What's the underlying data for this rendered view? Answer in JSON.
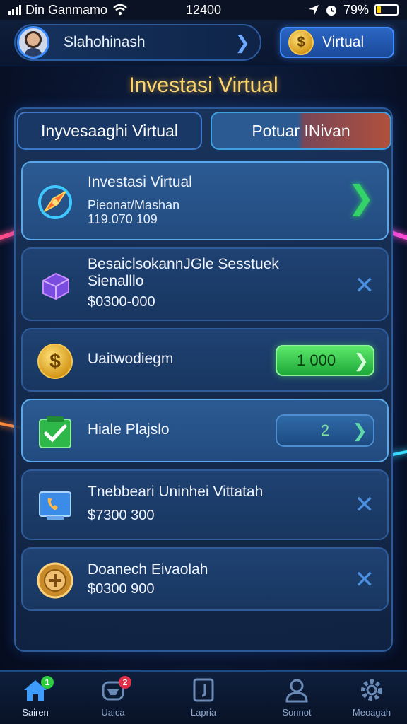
{
  "status_bar": {
    "carrier": "Din Ganmamo",
    "time": "12400",
    "battery": "79%"
  },
  "header": {
    "user_name": "Slahohinash",
    "virtual_label": "Virtual",
    "coin_symbol": "$"
  },
  "page_title": "Investasi Virtual",
  "tabs": [
    {
      "label": "Inyvesaaghi Virtual"
    },
    {
      "label": "Potuar INivan"
    }
  ],
  "cards": [
    {
      "title": "Investasi Virtual",
      "subtitle": "Pieonat/Mashan",
      "value": "119.070 109",
      "icon": "compass-icon"
    },
    {
      "title": "BesaiclsokannJGle Sesstuek",
      "subtitle": "Sienalllo",
      "value": "$0300-000",
      "icon": "cube-icon"
    },
    {
      "title": "Uaitwodiegm",
      "button_label": "1 000",
      "icon": "coin-icon"
    },
    {
      "title": "Hiale Plajslo",
      "button_label": "2",
      "icon": "check-icon"
    },
    {
      "title": "Tnebbeari Uninhei Vittatah",
      "value": "$7300 300",
      "icon": "phone-screen-icon"
    },
    {
      "title": "Doanech Eivaolah",
      "value": "$0300 900",
      "icon": "gear-badge-icon"
    }
  ],
  "bottom_nav": [
    {
      "label": "Sairen",
      "badge": "1",
      "badge_color": "#2ecc40"
    },
    {
      "label": "Uaica",
      "badge": "2",
      "badge_color": "#e0304a"
    },
    {
      "label": "Lapria"
    },
    {
      "label": "Sonnot"
    },
    {
      "label": "Meoagah"
    }
  ]
}
